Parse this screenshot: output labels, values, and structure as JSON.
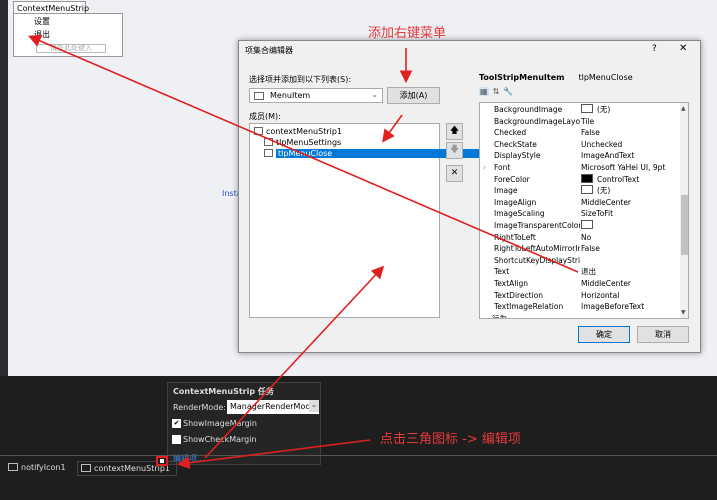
{
  "designer": {
    "cms_tab": "ContextMenuStrip",
    "menu_items": [
      "设置",
      "退出"
    ],
    "type_here": "请在此处键入",
    "partial_text": "Insta"
  },
  "dialog": {
    "title": "项集合编辑器",
    "help": "?",
    "close": "✕",
    "select_label": "选择项并添加到以下列表(S):",
    "combo_value": "MenuItem",
    "add_button": "添加(A)",
    "members_label": "成员(M):",
    "members": {
      "root": "contextMenuStrip1",
      "children": [
        "tlpMenuSettings",
        "tlpMenuClose"
      ]
    },
    "side_buttons": {
      "up": "🡅",
      "down": "🡇",
      "delete": "✕"
    },
    "property_grid": {
      "type_name": "ToolStripMenuItem",
      "object_name": "tlpMenuClose",
      "rows": [
        {
          "key": "BackgroundImage",
          "value": "(无)",
          "swatch": "white"
        },
        {
          "key": "BackgroundImageLayout",
          "value": "Tile"
        },
        {
          "key": "Checked",
          "value": "False"
        },
        {
          "key": "CheckState",
          "value": "Unchecked"
        },
        {
          "key": "DisplayStyle",
          "value": "ImageAndText"
        },
        {
          "key": "Font",
          "value": "Microsoft YaHei UI, 9pt",
          "expandable": true
        },
        {
          "key": "ForeColor",
          "value": "ControlText",
          "swatch": "black"
        },
        {
          "key": "Image",
          "value": "(无)",
          "swatch": "white"
        },
        {
          "key": "ImageAlign",
          "value": "MiddleCenter"
        },
        {
          "key": "ImageScaling",
          "value": "SizeToFit"
        },
        {
          "key": "ImageTransparentColor",
          "value": "",
          "swatch": "white"
        },
        {
          "key": "RightToLeft",
          "value": "No"
        },
        {
          "key": "RightToLeftAutoMirrorImage",
          "value": "False"
        },
        {
          "key": "ShortcutKeyDisplayString",
          "value": ""
        },
        {
          "key": "Text",
          "value": "退出"
        },
        {
          "key": "TextAlign",
          "value": "MiddleCenter"
        },
        {
          "key": "TextDirection",
          "value": "Horizontal"
        },
        {
          "key": "TextImageRelation",
          "value": "ImageBeforeText"
        },
        {
          "key": "行为",
          "value": "",
          "category": true
        }
      ]
    },
    "ok": "确定",
    "cancel": "取消"
  },
  "tasks": {
    "title": "ContextMenuStrip 任务",
    "render_mode_label": "RenderMode:",
    "render_mode_value": "ManagerRenderMode",
    "show_image_margin": "ShowImageMargin",
    "show_image_margin_checked": true,
    "show_check_margin": "ShowCheckMargin",
    "show_check_margin_checked": false,
    "edit_items_link": "编辑项..."
  },
  "tray": {
    "components": [
      "notifyIcon1",
      "contextMenuStrip1"
    ]
  },
  "annotations": {
    "add_menu": "添加右键菜单",
    "click_triangle": "点击三角图标 -> 编辑项"
  },
  "colors": {
    "annotation": "#e53a3a",
    "selection": "#0078d7"
  }
}
